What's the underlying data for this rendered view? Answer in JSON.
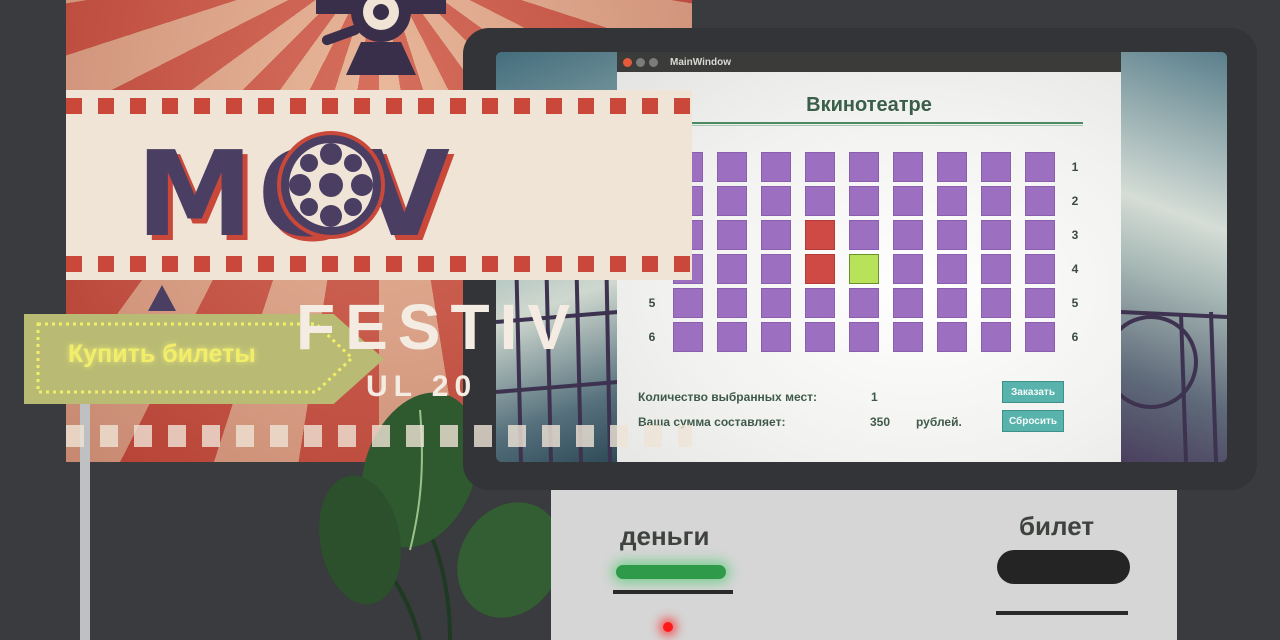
{
  "poster": {
    "word1": "MOV",
    "word2": "FESTIV",
    "word3": "UL 20"
  },
  "sign": {
    "label": "Купить билеты",
    "neon_color": "#f2ee6a"
  },
  "kiosk": {
    "money_label": "деньги",
    "ticket_label": "билет",
    "money_led_color": "#ff1a1a",
    "money_slot_color": "#2f9a4a"
  },
  "app": {
    "window_title": "MainWindow",
    "heading": "Вкинотеатре",
    "rows": [
      "1",
      "2",
      "3",
      "4",
      "5",
      "6"
    ],
    "seats_per_row": 9,
    "seat_states": [
      [
        "free",
        "free",
        "free",
        "free",
        "free",
        "free",
        "free",
        "free",
        "free"
      ],
      [
        "free",
        "free",
        "free",
        "free",
        "free",
        "free",
        "free",
        "free",
        "free"
      ],
      [
        "free",
        "free",
        "free",
        "taken",
        "free",
        "free",
        "free",
        "free",
        "free"
      ],
      [
        "free",
        "free",
        "free",
        "taken",
        "selected",
        "free",
        "free",
        "free",
        "free"
      ],
      [
        "free",
        "free",
        "free",
        "free",
        "free",
        "free",
        "free",
        "free",
        "free"
      ],
      [
        "free",
        "free",
        "free",
        "free",
        "free",
        "free",
        "free",
        "free",
        "free"
      ]
    ],
    "colors": {
      "free": "#9c6fc0",
      "taken": "#cf4a45",
      "selected": "#b7e25a",
      "button": "#59b3ad"
    },
    "selected_count_label": "Количество выбранных мест:",
    "selected_count_value": "1",
    "sum_label": "Ваша сумма составляет:",
    "sum_value": "350",
    "currency": "рублей.",
    "order_button": "Заказать",
    "reset_button": "Сбросить"
  }
}
